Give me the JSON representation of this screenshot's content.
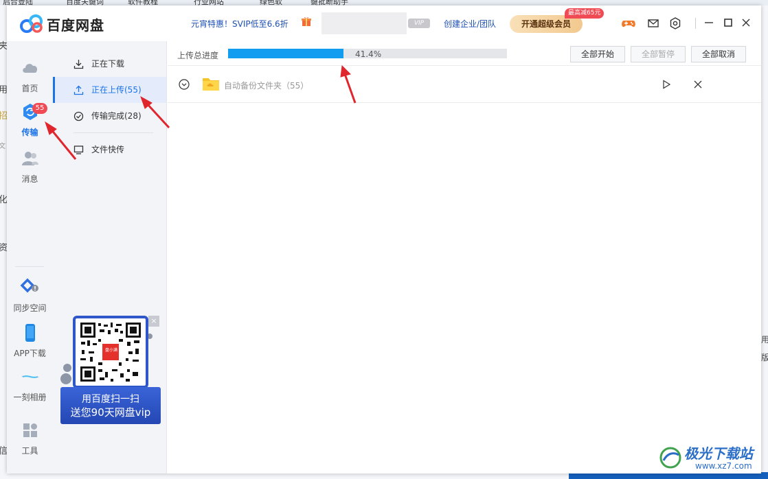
{
  "desktop": {
    "top_snippets": [
      "启合登陆",
      "百度关键词",
      "软件教程",
      "行业网站",
      "绿色软",
      "键批断助手"
    ],
    "left_snippets": [
      "夹",
      "用",
      "招",
      "文",
      "化",
      "资",
      "信"
    ],
    "right_snippets": [
      "用",
      "版"
    ]
  },
  "titlebar": {
    "app_name": "百度网盘",
    "promo": "元宵特惠！SVIP低至6.6折",
    "vip_badge": "VIP",
    "enterprise_link": "创建企业/团队",
    "svip_button": "开通超级会员",
    "discount_badge": "最高减65元"
  },
  "rail": {
    "items": [
      {
        "label": "首页",
        "icon": "cloud-icon"
      },
      {
        "label": "传输",
        "icon": "transfer-icon",
        "badge": "55",
        "active": true
      },
      {
        "label": "消息",
        "icon": "people-icon"
      },
      {
        "label": "同步空间",
        "icon": "sync-icon"
      },
      {
        "label": "APP下载",
        "icon": "phone-icon"
      },
      {
        "label": "一刻相册",
        "icon": "album-icon"
      },
      {
        "label": "工具",
        "icon": "tools-icon"
      }
    ]
  },
  "subnav": {
    "items": [
      {
        "label": "正在下载",
        "icon": "download-icon"
      },
      {
        "label": "正在上传(55)",
        "icon": "upload-icon",
        "active": true
      },
      {
        "label": "传输完成(28)",
        "icon": "check-circle-icon"
      },
      {
        "label": "文件快传",
        "icon": "monitor-icon"
      }
    ]
  },
  "qr_ad": {
    "line1": "用百度扫一扫",
    "line2": "送您90天网盘vip",
    "close": "×",
    "center_text": "盘小满"
  },
  "transfer": {
    "progress_label": "上传总进度",
    "progress": 0.414,
    "progress_text": "41.4%",
    "buttons": {
      "start_all": "全部开始",
      "pause_all": "全部暂停",
      "cancel_all": "全部取消"
    },
    "tasks": [
      {
        "name": "自动备份文件夹（55）"
      }
    ]
  },
  "watermark": {
    "text": "极光下载站",
    "url": "www.xz7.com"
  },
  "colors": {
    "accent": "#1a73e8",
    "progress": "#139df1",
    "badge": "#f04a55",
    "arrow": "#e0262d"
  }
}
